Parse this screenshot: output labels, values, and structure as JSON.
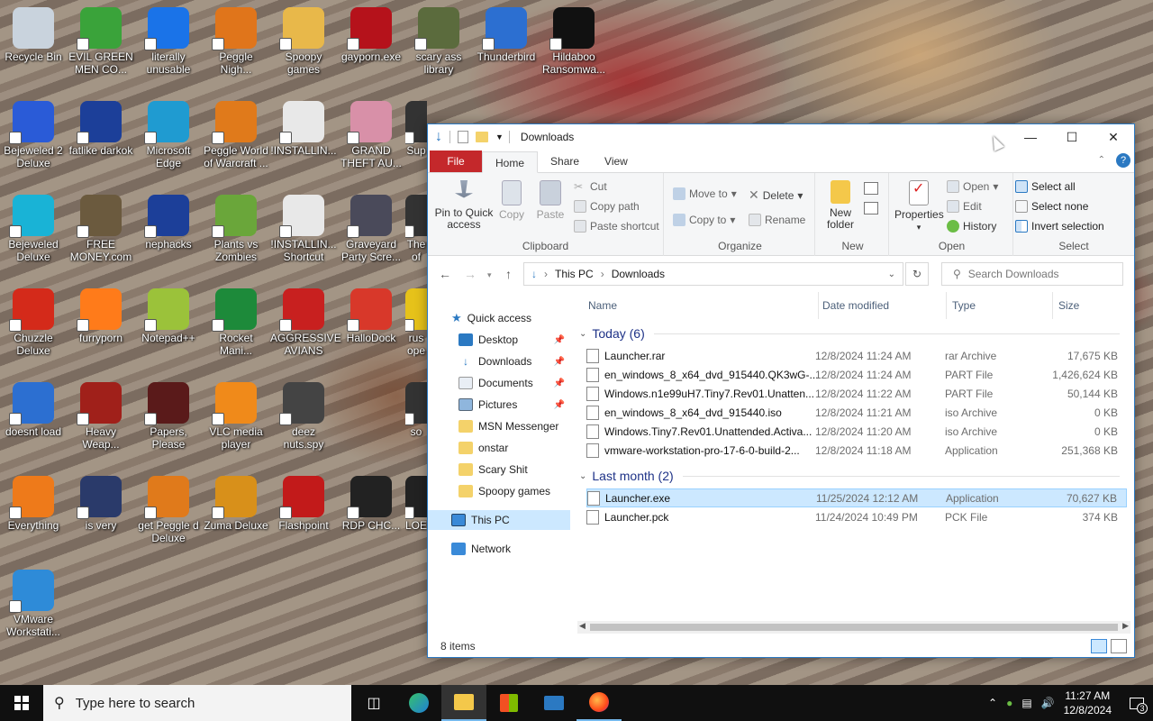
{
  "desktop": {
    "icons": [
      {
        "label": "Recycle Bin",
        "color": "#c9d3dd"
      },
      {
        "label": "EVIL GREEN MEN CO...",
        "color": "#3aa33a"
      },
      {
        "label": "literally unusable",
        "color": "#1a73e8"
      },
      {
        "label": "Peggle Nigh...",
        "color": "#e0751b"
      },
      {
        "label": "Spoopy games",
        "color": "#e8b84a"
      },
      {
        "label": "gayporn.exe",
        "color": "#b5121b"
      },
      {
        "label": "scary ass library",
        "color": "#5b6b3d"
      },
      {
        "label": "Thunderbird",
        "color": "#2c6fd1"
      },
      {
        "label": "Hildaboo Ransomwa...",
        "color": "#111111"
      },
      {
        "label": "Bejeweled 2 Deluxe",
        "color": "#2a5bd7"
      },
      {
        "label": "fatlike darkok",
        "color": "#1c3f99"
      },
      {
        "label": "Microsoft Edge",
        "color": "#1f9bd1"
      },
      {
        "label": "Peggle World of Warcraft ...",
        "color": "#e07a1b"
      },
      {
        "label": "!INSTALLIN...",
        "color": "#e8e8e8"
      },
      {
        "label": "GRAND THEFT AU...",
        "color": "#d890a8"
      },
      {
        "label": "Sup",
        "color": "#333333"
      },
      {
        "label": "Bejeweled Deluxe",
        "color": "#19b3d6"
      },
      {
        "label": "FREE MONEY.com",
        "color": "#6b5a3e"
      },
      {
        "label": "nephacks",
        "color": "#1c3f99"
      },
      {
        "label": "Plants vs Zombies",
        "color": "#6aa63a"
      },
      {
        "label": "!INSTALLIN... Shortcut",
        "color": "#e8e8e8"
      },
      {
        "label": "Graveyard Party Scre...",
        "color": "#4a4a5a"
      },
      {
        "label": "The of",
        "color": "#333333"
      },
      {
        "label": "Chuzzle Deluxe",
        "color": "#d42a1a"
      },
      {
        "label": "furryporn",
        "color": "#ff7b1a"
      },
      {
        "label": "Notepad++",
        "color": "#9bc23a"
      },
      {
        "label": "Rocket Mani...",
        "color": "#1d8a3a"
      },
      {
        "label": "AGGRESSIVE AVIANS",
        "color": "#c8201f"
      },
      {
        "label": "HalloDock",
        "color": "#d8382a"
      },
      {
        "label": "rus ope",
        "color": "#e6c21a"
      },
      {
        "label": "doesnt load",
        "color": "#2c6fd1"
      },
      {
        "label": "Heavy Weap...",
        "color": "#a0201a"
      },
      {
        "label": "Papers, Please",
        "color": "#5a1a1a"
      },
      {
        "label": "VLC media player",
        "color": "#f08a1a"
      },
      {
        "label": "deez nuts.spy",
        "color": "#444444"
      },
      {
        "label": "so",
        "color": "#333333"
      },
      {
        "label": "Everything",
        "color": "#ee7a1a"
      },
      {
        "label": "is very",
        "color": "#2a3a6a"
      },
      {
        "label": "get Peggle d Deluxe",
        "color": "#e07a1b"
      },
      {
        "label": "Zuma Deluxe",
        "color": "#d8901a"
      },
      {
        "label": "Flashpoint",
        "color": "#c21a1a"
      },
      {
        "label": "RDP CHC...",
        "color": "#222222"
      },
      {
        "label": "LOE",
        "color": "#222222"
      },
      {
        "label": "VMware Workstati...",
        "color": "#2e8bd8"
      }
    ]
  },
  "explorer": {
    "title": "Downloads",
    "tabs": [
      "File",
      "Home",
      "Share",
      "View"
    ],
    "ribbon": {
      "pin_label": "Pin to Quick access",
      "copy": "Copy",
      "paste": "Paste",
      "cut": "Cut",
      "copy_path": "Copy path",
      "paste_shortcut": "Paste shortcut",
      "clipboard": "Clipboard",
      "move_to": "Move to",
      "copy_to": "Copy to",
      "delete": "Delete",
      "rename": "Rename",
      "organize": "Organize",
      "new_folder": "New folder",
      "new": "New",
      "properties": "Properties",
      "open": "Open",
      "edit": "Edit",
      "history": "History",
      "open_group": "Open",
      "select_all": "Select all",
      "select_none": "Select none",
      "invert_selection": "Invert selection",
      "select_group": "Select"
    },
    "address": {
      "crumb1": "This PC",
      "crumb2": "Downloads",
      "search_placeholder": "Search Downloads"
    },
    "nav": {
      "quick_access": "Quick access",
      "desktop": "Desktop",
      "downloads": "Downloads",
      "documents": "Documents",
      "pictures": "Pictures",
      "msn": "MSN Messenger",
      "onstar": "onstar",
      "scary": "Scary Shit",
      "spoopy": "Spoopy games",
      "this_pc": "This PC",
      "network": "Network"
    },
    "columns": {
      "name": "Name",
      "date": "Date modified",
      "type": "Type",
      "size": "Size"
    },
    "groups": {
      "today": "Today (6)",
      "last_month": "Last month (2)"
    },
    "today_files": [
      {
        "name": "Launcher.rar",
        "date": "12/8/2024 11:24 AM",
        "type": "rar Archive",
        "size": "17,675 KB"
      },
      {
        "name": "en_windows_8_x64_dvd_915440.QK3wG-...",
        "date": "12/8/2024 11:24 AM",
        "type": "PART File",
        "size": "1,426,624 KB"
      },
      {
        "name": "Windows.n1e99uH7.Tiny7.Rev01.Unatten...",
        "date": "12/8/2024 11:22 AM",
        "type": "PART File",
        "size": "50,144 KB"
      },
      {
        "name": "en_windows_8_x64_dvd_915440.iso",
        "date": "12/8/2024 11:21 AM",
        "type": "iso Archive",
        "size": "0 KB"
      },
      {
        "name": "Windows.Tiny7.Rev01.Unattended.Activa...",
        "date": "12/8/2024 11:20 AM",
        "type": "iso Archive",
        "size": "0 KB"
      },
      {
        "name": "vmware-workstation-pro-17-6-0-build-2...",
        "date": "12/8/2024 11:18 AM",
        "type": "Application",
        "size": "251,368 KB"
      }
    ],
    "month_files": [
      {
        "name": "Launcher.exe",
        "date": "11/25/2024 12:12 AM",
        "type": "Application",
        "size": "70,627 KB"
      },
      {
        "name": "Launcher.pck",
        "date": "11/24/2024 10:49 PM",
        "type": "PCK File",
        "size": "374 KB"
      }
    ],
    "status": "8 items"
  },
  "taskbar": {
    "search_placeholder": "Type here to search",
    "time": "11:27 AM",
    "date": "12/8/2024",
    "notif_count": "3"
  }
}
